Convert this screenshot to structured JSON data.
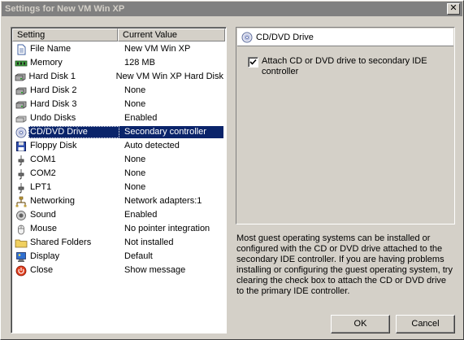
{
  "window": {
    "title": "Settings for New VM Win XP"
  },
  "list": {
    "headers": {
      "setting": "Setting",
      "value": "Current Value"
    },
    "rows": [
      {
        "icon": "file-icon",
        "setting": "File Name",
        "value": "New VM Win XP"
      },
      {
        "icon": "memory-icon",
        "setting": "Memory",
        "value": "128 MB"
      },
      {
        "icon": "hard-disk-icon",
        "setting": "Hard Disk 1",
        "value": "New VM Win XP Hard Disk"
      },
      {
        "icon": "hard-disk-icon",
        "setting": "Hard Disk 2",
        "value": "None"
      },
      {
        "icon": "hard-disk-icon",
        "setting": "Hard Disk 3",
        "value": "None"
      },
      {
        "icon": "undo-disk-icon",
        "setting": "Undo Disks",
        "value": "Enabled"
      },
      {
        "icon": "cd-drive-icon",
        "setting": "CD/DVD Drive",
        "value": "Secondary controller",
        "selected": true
      },
      {
        "icon": "floppy-icon",
        "setting": "Floppy Disk",
        "value": "Auto detected"
      },
      {
        "icon": "com-port-icon",
        "setting": "COM1",
        "value": "None"
      },
      {
        "icon": "com-port-icon",
        "setting": "COM2",
        "value": "None"
      },
      {
        "icon": "lpt-port-icon",
        "setting": "LPT1",
        "value": "None"
      },
      {
        "icon": "network-icon",
        "setting": "Networking",
        "value": "Network adapters:1"
      },
      {
        "icon": "sound-icon",
        "setting": "Sound",
        "value": "Enabled"
      },
      {
        "icon": "mouse-icon",
        "setting": "Mouse",
        "value": "No pointer integration"
      },
      {
        "icon": "folder-icon",
        "setting": "Shared Folders",
        "value": "Not installed"
      },
      {
        "icon": "display-icon",
        "setting": "Display",
        "value": "Default"
      },
      {
        "icon": "close-power-icon",
        "setting": "Close",
        "value": "Show message"
      }
    ]
  },
  "detail": {
    "header": "CD/DVD Drive",
    "checkbox_label": "Attach CD or DVD drive to secondary IDE controller",
    "checkbox_checked": true,
    "description": "Most guest operating systems can be installed or configured with the CD or DVD drive attached to the secondary IDE controller. If you are having problems installing or configuring the guest operating system, try clearing the check box to attach the CD or DVD drive to the primary IDE controller."
  },
  "buttons": {
    "ok": "OK",
    "cancel": "Cancel"
  },
  "colors": {
    "selection": "#0a246a",
    "face": "#d4d0c8",
    "titlebar_inactive": "#808080"
  }
}
